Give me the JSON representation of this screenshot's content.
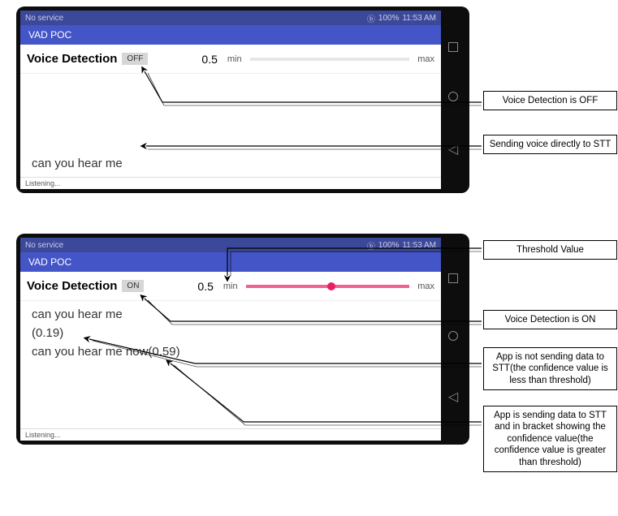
{
  "statusbar": {
    "left": "No service",
    "battery": "100%",
    "time": "11:53 AM"
  },
  "appbar": {
    "title": "VAD POC"
  },
  "controls": {
    "label": "Voice Detection",
    "off": "OFF",
    "on": "ON",
    "threshold": "0.5",
    "min": "min",
    "max": "max"
  },
  "screen1": {
    "lines": [
      "can you hear me"
    ],
    "status": "Listening..."
  },
  "screen2": {
    "lines": [
      "can you hear me",
      "(0.19)",
      "can you hear me now(0.59)"
    ],
    "status": "Listening..."
  },
  "annot": {
    "a1": "Voice Detection is OFF",
    "a2": "Sending voice directly to STT",
    "b1": "Threshold Value",
    "b2": "Voice Detection is ON",
    "b3": "App is not sending data to STT(the confidence value is less than threshold)",
    "b4": "App is sending data to STT and in bracket showing the confidence value(the confidence value is greater than threshold)"
  }
}
